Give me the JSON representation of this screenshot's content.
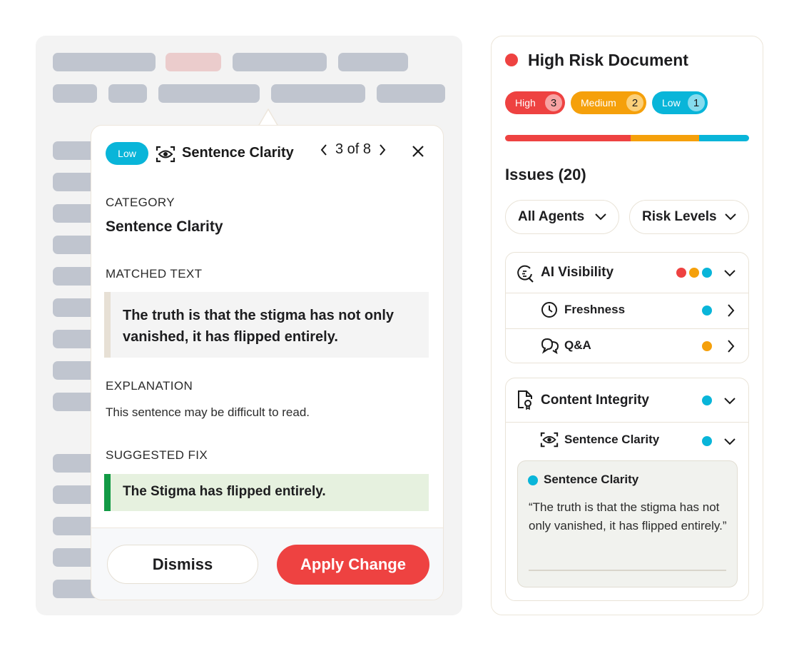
{
  "popover": {
    "severity_badge": "Low",
    "title": "Sentence Clarity",
    "pager": "3 of 8",
    "category_label": "CATEGORY",
    "category_value": "Sentence Clarity",
    "matched_label": "MATCHED TEXT",
    "matched_text": "The truth is that the stigma has not only vanished, it has flipped entirely.",
    "explanation_label": "EXPLANATION",
    "explanation_text": "This sentence may be difficult to read.",
    "fix_label": "SUGGESTED FIX",
    "fix_text": "The Stigma has flipped entirely.",
    "dismiss_label": "Dismiss",
    "apply_label": "Apply Change"
  },
  "panel": {
    "title": "High Risk Document",
    "risk_pills": [
      {
        "label": "High",
        "count": "3",
        "color": "#ee4241",
        "count_bg": "#f7a3a3"
      },
      {
        "label": "Medium",
        "count": "2",
        "color": "#f5a00b",
        "count_bg": "#fbd07a"
      },
      {
        "label": "Low",
        "count": "1",
        "color": "#09b5d9",
        "count_bg": "#86dcee"
      }
    ],
    "issues_heading": "Issues (20)",
    "filters": [
      {
        "label": "All Agents"
      },
      {
        "label": "Risk Levels"
      }
    ],
    "groups": [
      {
        "title": "AI Visibility",
        "icon": "ai-visibility-icon",
        "rows": [
          {
            "title": "Freshness",
            "icon": "clock-icon"
          },
          {
            "title": "Q&A",
            "icon": "chat-bubbles-icon"
          }
        ]
      },
      {
        "title": "Content Integrity",
        "icon": "document-check-icon",
        "rows": [
          {
            "title": "Sentence Clarity",
            "icon": "eye-scan-icon"
          }
        ],
        "detail": {
          "title": "Sentence Clarity",
          "quote": "“The truth is that the stigma has not only vanished, it has flipped entirely.”"
        }
      }
    ]
  },
  "colors": {
    "high": "#ee4241",
    "medium": "#f5a00b",
    "low": "#09b5d9",
    "fix_accent": "#129a45"
  }
}
